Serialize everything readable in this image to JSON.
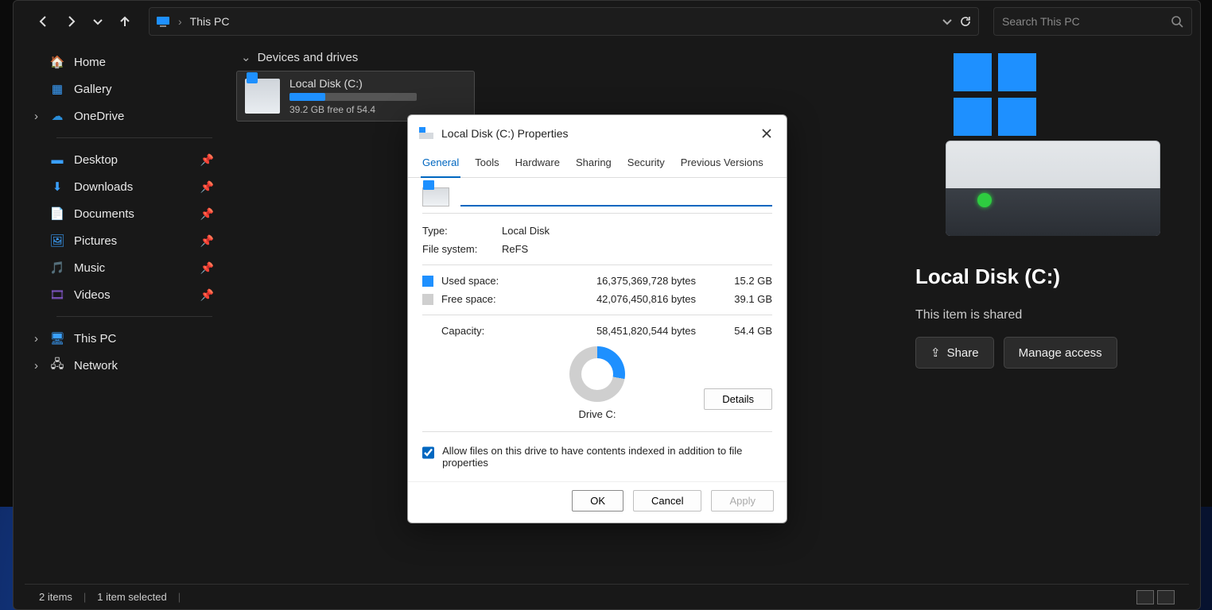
{
  "address": {
    "crumb": "This PC"
  },
  "search": {
    "placeholder": "Search This PC"
  },
  "sidebar": {
    "home": "Home",
    "gallery": "Gallery",
    "onedrive": "OneDrive",
    "desktop": "Desktop",
    "downloads": "Downloads",
    "documents": "Documents",
    "pictures": "Pictures",
    "music": "Music",
    "videos": "Videos",
    "thispc": "This PC",
    "network": "Network"
  },
  "main": {
    "group": "Devices and drives",
    "drive": {
      "name": "Local Disk (C:)",
      "freeof": "39.2 GB free of 54.4",
      "fill_pct": 28
    }
  },
  "preview": {
    "title": "Local Disk (C:)",
    "shared": "This item is shared",
    "share_btn": "Share",
    "manage_btn": "Manage access"
  },
  "status": {
    "items": "2 items",
    "selected": "1 item selected"
  },
  "dialog": {
    "title": "Local Disk (C:) Properties",
    "tabs": {
      "general": "General",
      "tools": "Tools",
      "hardware": "Hardware",
      "sharing": "Sharing",
      "security": "Security",
      "previous": "Previous Versions"
    },
    "name_value": "",
    "type_k": "Type:",
    "type_v": "Local Disk",
    "fs_k": "File system:",
    "fs_v": "ReFS",
    "used_k": "Used space:",
    "used_bytes": "16,375,369,728 bytes",
    "used_gb": "15.2 GB",
    "free_k": "Free space:",
    "free_bytes": "42,076,450,816 bytes",
    "free_gb": "39.1 GB",
    "cap_k": "Capacity:",
    "cap_bytes": "58,451,820,544 bytes",
    "cap_gb": "54.4 GB",
    "drive_label": "Drive C:",
    "details": "Details",
    "index_chk": "Allow files on this drive to have contents indexed in addition to file properties",
    "ok": "OK",
    "cancel": "Cancel",
    "apply": "Apply"
  },
  "chart_data": {
    "type": "pie",
    "title": "Drive C:",
    "series": [
      {
        "name": "Used space",
        "value": 15.2,
        "unit": "GB",
        "bytes": 16375369728,
        "color": "#1e90ff"
      },
      {
        "name": "Free space",
        "value": 39.1,
        "unit": "GB",
        "bytes": 42076450816,
        "color": "#cfcfcf"
      }
    ],
    "total": {
      "name": "Capacity",
      "value": 54.4,
      "unit": "GB",
      "bytes": 58451820544
    }
  }
}
